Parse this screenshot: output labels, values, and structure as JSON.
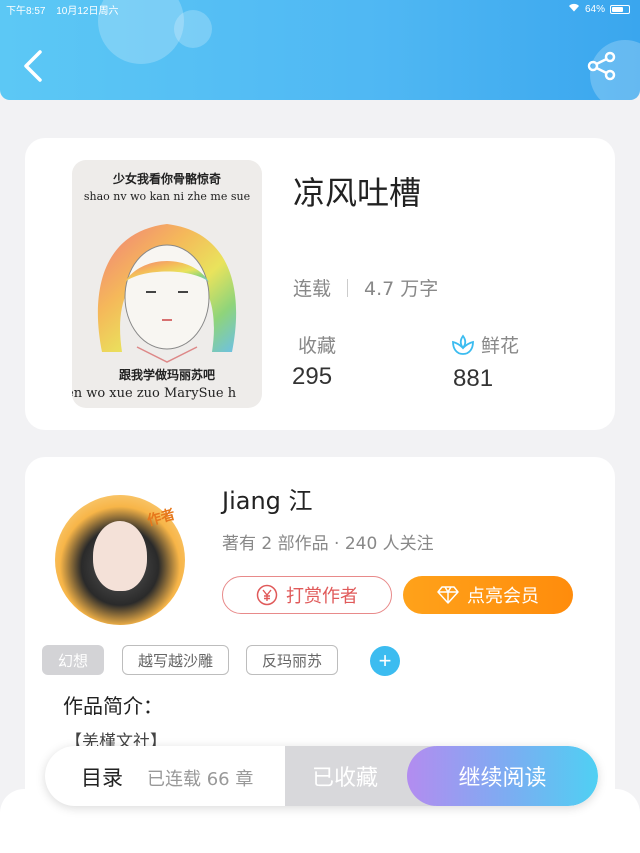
{
  "status_bar": {
    "time": "下午8:57",
    "date": "10月12日周六",
    "battery": "64%"
  },
  "header": {
    "back_icon": "chevron-left-icon",
    "share_icon": "share-icon",
    "color": "#4fb7f3"
  },
  "book": {
    "cover_text_top": "少女我看你骨骼惊奇",
    "cover_text_top_pinyin": "shao nv wo kan ni zhe me sue",
    "cover_text_bottom": "跟我学做玛丽苏吧",
    "cover_text_bottom_pinyin": "en wo xue zuo MarySue h",
    "title": "凉风吐槽",
    "status": "连载",
    "word_count": "4.7 万字",
    "favorites_label": "收藏",
    "favorites_value": "295",
    "flowers_label": "鲜花",
    "flowers_value": "881"
  },
  "author": {
    "avatar_badge": "作者",
    "name": "Jiang 江",
    "info": "著有 2 部作品 · 240 人关注",
    "tip_label": "打赏作者",
    "vip_label": "点亮会员",
    "tags": [
      "幻想",
      "越写越沙雕",
      "反玛丽苏"
    ],
    "add_tag": "+",
    "intro_label": "作品简介：",
    "intro_text": "【羌槿文社】"
  },
  "bottom_bar": {
    "toc_label": "目录",
    "chapter_count": "已连载 66 章",
    "favorited_label": "已收藏",
    "read_label": "继续阅读"
  },
  "colors": {
    "accent": "#3cbcf0",
    "vip": "#ff9a14",
    "tip": "#e05a5a"
  }
}
